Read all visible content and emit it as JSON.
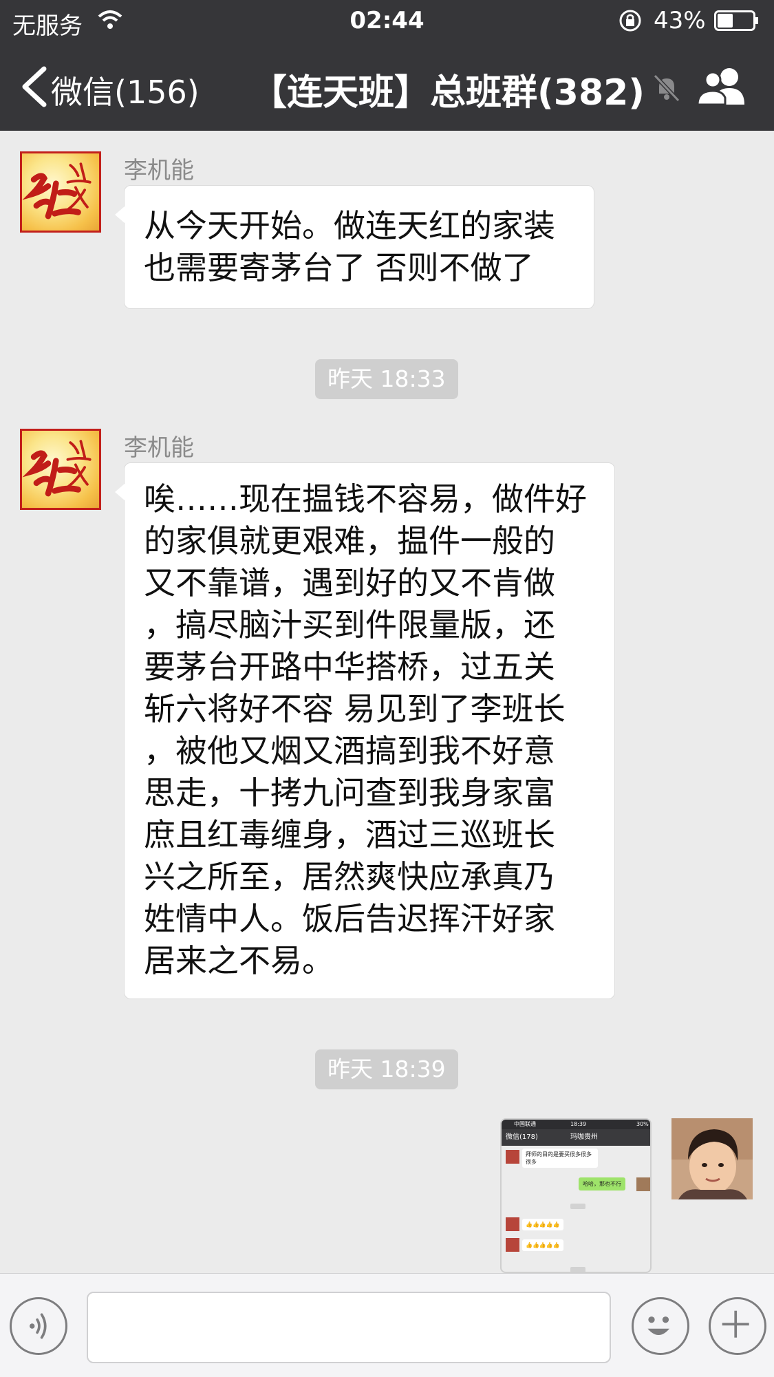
{
  "status_bar": {
    "carrier": "无服务",
    "time": "02:44",
    "battery_percent": "43%",
    "battery_level": 0.43
  },
  "nav": {
    "back_label": "微信(156)",
    "title": "【连天班】总班群(382)"
  },
  "messages": [
    {
      "sender": "李机能",
      "lines": [
        "从今天开始。做连天红的家装",
        "也需要寄茅台了  否则不做了"
      ]
    },
    {
      "sender": "李机能",
      "lines": [
        "唉……现在揾钱不容易，做件好",
        "的家俱就更艰难，揾件一般的",
        "又不靠谱，遇到好的又不肯做",
        "，搞尽脑汁买到件限量版，还",
        "要茅台开路中华搭桥，过五关",
        "斩六将好不容 易见到了李班长",
        "，被他又烟又酒搞到我不好意",
        "思走，十拷九问查到我身家富",
        "庶且红毒缠身，酒过三巡班长",
        "兴之所至，居然爽快应承真乃",
        "姓情中人。饭后告迟挥汗好家",
        "居来之不易。"
      ]
    }
  ],
  "timestamps": [
    "昨天 18:33",
    "昨天 18:39"
  ],
  "screenshot_thumb": {
    "carrier": "中国联通",
    "time": "18:39",
    "battery": "30%",
    "back_label": "微信(178)",
    "title": "玛咖贵州",
    "msg1": "拜师的目的是要买很多很多很多",
    "msg2": "哈哈，那也不行",
    "msg3": "👍👍👍👍👍",
    "msg4": "👍👍👍👍👍"
  },
  "icons": {
    "back": "chevron-left-icon",
    "mute": "mute-bell-icon",
    "group": "group-members-icon",
    "voice": "voice-icon",
    "emoji": "emoji-icon",
    "plus": "plus-icon"
  }
}
